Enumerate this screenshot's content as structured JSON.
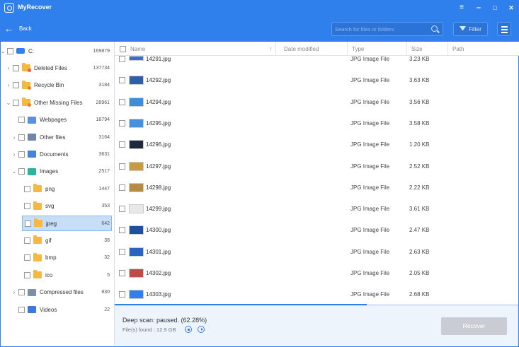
{
  "titlebar": {
    "app_title": "MyRecover",
    "minimize_glyph": "–",
    "maximize_glyph": "□",
    "close_glyph": "✕",
    "menu_glyph": "≡"
  },
  "toolbar": {
    "back_label": "Back",
    "search_placeholder": "Search for files or folders",
    "filter_label": "Filter"
  },
  "colors": {
    "accent": "#2f80ed",
    "selected_row": "#c6def7",
    "recover_disabled": "#c9cdd3"
  },
  "tree": [
    {
      "label": "C:",
      "count": "169879",
      "icon": "drive-icon",
      "level": 0,
      "expanded": true
    },
    {
      "label": "Deleted Files",
      "count": "137734",
      "icon": "folder-deleted-icon",
      "level": 1,
      "expanded": false
    },
    {
      "label": "Recycle Bin",
      "count": "3184",
      "icon": "folder-recycle-icon",
      "level": 1,
      "expanded": false
    },
    {
      "label": "Other Missing Files",
      "count": "28961",
      "icon": "folder-missing-icon",
      "level": 1,
      "expanded": true
    },
    {
      "label": "Webpages",
      "count": "18794",
      "icon": "webpage-icon",
      "level": 2,
      "expanded": null
    },
    {
      "label": "Other files",
      "count": "3164",
      "icon": "other-files-icon",
      "level": 2,
      "expanded": false
    },
    {
      "label": "Documents",
      "count": "3631",
      "icon": "document-icon",
      "level": 2,
      "expanded": false
    },
    {
      "label": "Images",
      "count": "2517",
      "icon": "image-icon",
      "level": 2,
      "expanded": true
    },
    {
      "label": "png",
      "count": "1447",
      "icon": "folder-icon",
      "level": 3,
      "expanded": null
    },
    {
      "label": "svg",
      "count": "353",
      "icon": "folder-icon",
      "level": 3,
      "expanded": null
    },
    {
      "label": "jpeg",
      "count": "642",
      "icon": "folder-icon",
      "level": 3,
      "expanded": null,
      "selected": true
    },
    {
      "label": "gif",
      "count": "38",
      "icon": "folder-icon",
      "level": 3,
      "expanded": null
    },
    {
      "label": "bmp",
      "count": "32",
      "icon": "folder-icon",
      "level": 3,
      "expanded": null
    },
    {
      "label": "ico",
      "count": "5",
      "icon": "folder-icon",
      "level": 3,
      "expanded": null
    },
    {
      "label": "Compressed files",
      "count": "830",
      "icon": "compressed-icon",
      "level": 2,
      "expanded": false
    },
    {
      "label": "Videos",
      "count": "22",
      "icon": "video-icon",
      "level": 2,
      "expanded": null
    }
  ],
  "table": {
    "columns": [
      "Name",
      "Date modified",
      "Type",
      "Size",
      "Path"
    ],
    "rows": [
      {
        "name": "14291.jpg",
        "type": "JPG Image File",
        "size": "3.23 KB",
        "thumb": "#3a6fc4"
      },
      {
        "name": "14292.jpg",
        "type": "JPG Image File",
        "size": "3.63 KB",
        "thumb": "#2f5fa8"
      },
      {
        "name": "14294.jpg",
        "type": "JPG Image File",
        "size": "3.56 KB",
        "thumb": "#3a8ee0"
      },
      {
        "name": "14295.jpg",
        "type": "JPG Image File",
        "size": "3.58 KB",
        "thumb": "#4a90d9"
      },
      {
        "name": "14296.jpg",
        "type": "JPG Image File",
        "size": "1.20 KB",
        "thumb": "#1e2a3a"
      },
      {
        "name": "14297.jpg",
        "type": "JPG Image File",
        "size": "2.52 KB",
        "thumb": "#c99a3e"
      },
      {
        "name": "14298.jpg",
        "type": "JPG Image File",
        "size": "2.22 KB",
        "thumb": "#b88a4a"
      },
      {
        "name": "14299.jpg",
        "type": "JPG Image File",
        "size": "3.61 KB",
        "thumb": "#e8e8e8"
      },
      {
        "name": "14300.jpg",
        "type": "JPG Image File",
        "size": "2.47 KB",
        "thumb": "#1f4fa0"
      },
      {
        "name": "14301.jpg",
        "type": "JPG Image File",
        "size": "2.63 KB",
        "thumb": "#2a63c0"
      },
      {
        "name": "14302.jpg",
        "type": "JPG Image File",
        "size": "2.05 KB",
        "thumb": "#c04a4a"
      },
      {
        "name": "14303.jpg",
        "type": "JPG Image File",
        "size": "2.68 KB",
        "thumb": "#2f80ed"
      }
    ]
  },
  "status": {
    "scan_status": "Deep scan: paused. (62.28%)",
    "progress_percent": 62.28,
    "files_found": "File(s) found : 12.9 GB",
    "recover_label": "Recover"
  }
}
